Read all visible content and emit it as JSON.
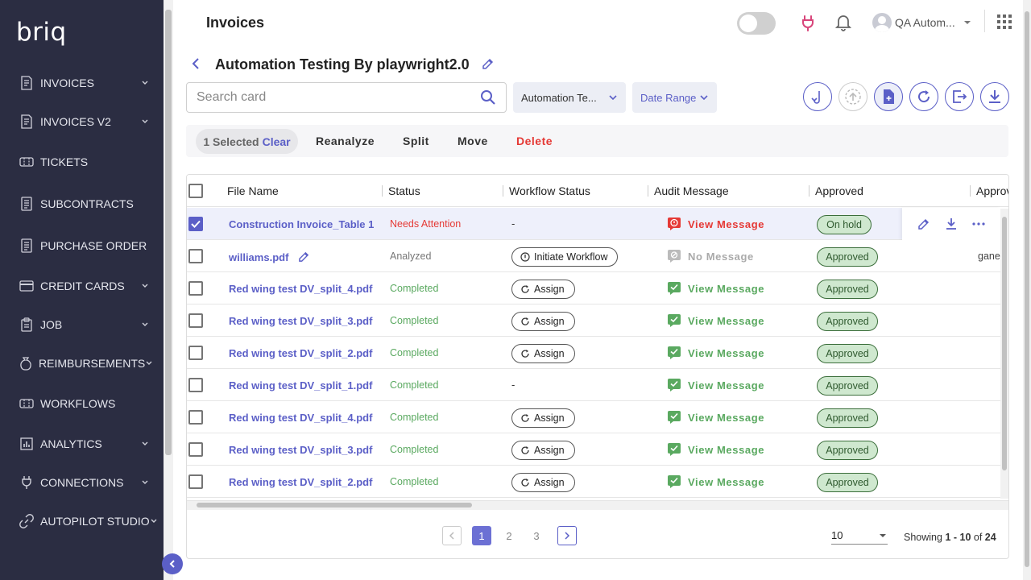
{
  "app": {
    "logo": "briq"
  },
  "sidebar": {
    "items": [
      {
        "label": "INVOICES",
        "icon": "invoice-icon",
        "has_children": true
      },
      {
        "label": "INVOICES V2",
        "icon": "invoice-icon",
        "has_children": true
      },
      {
        "label": "TICKETS",
        "icon": "tickets-icon",
        "has_children": false
      },
      {
        "label": "SUBCONTRACTS",
        "icon": "document-icon",
        "has_children": false
      },
      {
        "label": "PURCHASE ORDER",
        "icon": "document-icon",
        "has_children": false
      },
      {
        "label": "CREDIT CARDS",
        "icon": "credit-card-icon",
        "has_children": true
      },
      {
        "label": "JOB",
        "icon": "clipboard-icon",
        "has_children": true
      },
      {
        "label": "REIMBURSEMENTS",
        "icon": "money-bag-icon",
        "has_children": true
      },
      {
        "label": "WORKFLOWS",
        "icon": "workflow-icon",
        "has_children": false
      },
      {
        "label": "ANALYTICS",
        "icon": "analytics-icon",
        "has_children": true
      },
      {
        "label": "CONNECTIONS",
        "icon": "plug-icon",
        "has_children": true
      },
      {
        "label": "AUTOPILOT STUDIO",
        "icon": "link-icon",
        "has_children": true
      }
    ]
  },
  "header": {
    "title": "Invoices",
    "user_name": "QA Autom..."
  },
  "page": {
    "title": "Automation Testing By playwright2.0"
  },
  "filters": {
    "search_placeholder": "Search card",
    "company_dropdown": "Automation Te...",
    "date_range": "Date Range"
  },
  "actions": {
    "selected": "1 Selected",
    "clear": "Clear",
    "reanalyze": "Reanalyze",
    "split": "Split",
    "move": "Move",
    "delete": "Delete"
  },
  "table": {
    "columns": [
      "File Name",
      "Status",
      "Workflow Status",
      "Audit Message",
      "Approved",
      "Approv"
    ],
    "rows": [
      {
        "file": "Construction Invoice_Table 1",
        "status": "Needs Attention",
        "workflow": "-",
        "audit": "View Message",
        "approved": "On hold",
        "extra": "",
        "selected": true
      },
      {
        "file": "williams.pdf",
        "status": "Analyzed",
        "workflow": "Initiate Workflow",
        "audit": "No Message",
        "approved": "Approved",
        "extra": "gane",
        "selected": false
      },
      {
        "file": "Red wing test DV_split_4.pdf",
        "status": "Completed",
        "workflow": "Assign",
        "audit": "View Message",
        "approved": "Approved",
        "extra": "",
        "selected": false
      },
      {
        "file": "Red wing test DV_split_3.pdf",
        "status": "Completed",
        "workflow": "Assign",
        "audit": "View Message",
        "approved": "Approved",
        "extra": "",
        "selected": false
      },
      {
        "file": "Red wing test DV_split_2.pdf",
        "status": "Completed",
        "workflow": "Assign",
        "audit": "View Message",
        "approved": "Approved",
        "extra": "",
        "selected": false
      },
      {
        "file": "Red wing test DV_split_1.pdf",
        "status": "Completed",
        "workflow": "-",
        "audit": "View Message",
        "approved": "Approved",
        "extra": "",
        "selected": false
      },
      {
        "file": "Red wing test DV_split_4.pdf",
        "status": "Completed",
        "workflow": "Assign",
        "audit": "View Message",
        "approved": "Approved",
        "extra": "",
        "selected": false
      },
      {
        "file": "Red wing test DV_split_3.pdf",
        "status": "Completed",
        "workflow": "Assign",
        "audit": "View Message",
        "approved": "Approved",
        "extra": "",
        "selected": false
      },
      {
        "file": "Red wing test DV_split_2.pdf",
        "status": "Completed",
        "workflow": "Assign",
        "audit": "View Message",
        "approved": "Approved",
        "extra": "",
        "selected": false
      }
    ]
  },
  "pagination": {
    "pages": [
      "1",
      "2",
      "3"
    ],
    "current": "1",
    "page_size": "10",
    "showing_prefix": "Showing ",
    "showing_range": "1 - 10",
    "showing_of": " of ",
    "showing_total": "24"
  },
  "colors": {
    "sidebar_bg": "#2b2d42",
    "accent": "#5b5fc7",
    "danger": "#e53935",
    "success": "#5aa960",
    "approved_bg": "#cfe8cf"
  }
}
